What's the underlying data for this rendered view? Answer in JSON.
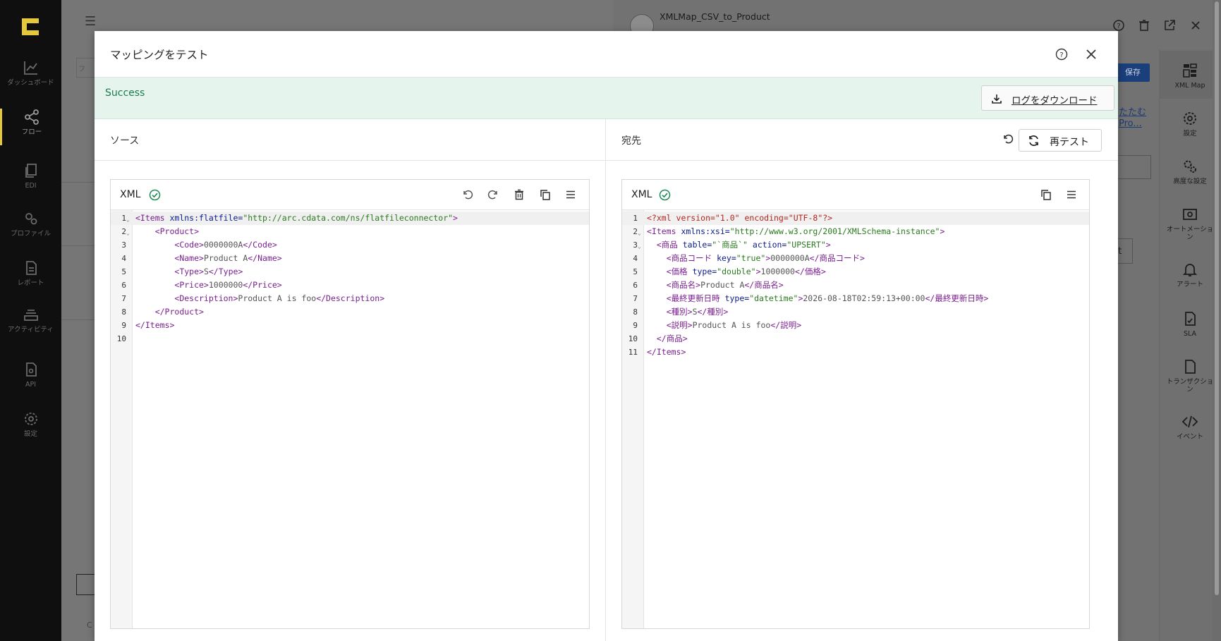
{
  "nav": {
    "items": [
      {
        "label": "ダッシュボード",
        "icon": "chart-line-icon"
      },
      {
        "label": "フロー",
        "icon": "share-flow-icon"
      },
      {
        "label": "EDI",
        "icon": "documents-icon"
      },
      {
        "label": "プロファイル",
        "icon": "gears-icon"
      },
      {
        "label": "レポート",
        "icon": "report-icon"
      },
      {
        "label": "アクティビティ",
        "icon": "stack-icon"
      },
      {
        "label": "API",
        "icon": "api-file-icon"
      },
      {
        "label": "設定",
        "icon": "gear-icon"
      }
    ],
    "active_index": 1
  },
  "background": {
    "flow_title": "XMLMap_CSV_to_Product",
    "save_label": "保存",
    "link1": "たたむ",
    "link2": "Pro...",
    "ct_label": "ct",
    "c_label": "C",
    "f_label": "フ"
  },
  "rail": {
    "items": [
      {
        "label": "XML Map",
        "icon": "xml-map-icon"
      },
      {
        "label": "設定",
        "icon": "gear-icon"
      },
      {
        "label": "高度な設定",
        "icon": "advanced-gears-icon"
      },
      {
        "label": "オートメーション",
        "icon": "automation-icon"
      },
      {
        "label": "アラート",
        "icon": "bell-icon"
      },
      {
        "label": "SLA",
        "icon": "sla-icon"
      },
      {
        "label": "トランザクション",
        "icon": "transaction-icon"
      },
      {
        "label": "イベント",
        "icon": "code-icon"
      }
    ]
  },
  "modal": {
    "title": "マッピングをテスト",
    "status": "Success",
    "download_label": "ログをダウンロード",
    "source_label": "ソース",
    "dest_label": "宛先",
    "retest_label": "再テスト",
    "source_editor": {
      "title": "XML",
      "lines": [
        [
          [
            "t-tag",
            "<Items "
          ],
          [
            "t-attr",
            "xmlns:flatfile="
          ],
          [
            "t-str",
            "\"http://arc.cdata.com/ns/flatfileconnector\""
          ],
          [
            "t-tag",
            ">"
          ]
        ],
        [
          [
            "t-txt",
            "    "
          ],
          [
            "t-tag",
            "<Product>"
          ]
        ],
        [
          [
            "t-txt",
            "        "
          ],
          [
            "t-tag",
            "<Code>"
          ],
          [
            "t-txt",
            "0000000A"
          ],
          [
            "t-tag",
            "</Code>"
          ]
        ],
        [
          [
            "t-txt",
            "        "
          ],
          [
            "t-tag",
            "<Name>"
          ],
          [
            "t-txt",
            "Product A"
          ],
          [
            "t-tag",
            "</Name>"
          ]
        ],
        [
          [
            "t-txt",
            "        "
          ],
          [
            "t-tag",
            "<Type>"
          ],
          [
            "t-txt",
            "S"
          ],
          [
            "t-tag",
            "</Type>"
          ]
        ],
        [
          [
            "t-txt",
            "        "
          ],
          [
            "t-tag",
            "<Price>"
          ],
          [
            "t-txt",
            "1000000"
          ],
          [
            "t-tag",
            "</Price>"
          ]
        ],
        [
          [
            "t-txt",
            "        "
          ],
          [
            "t-tag",
            "<Description>"
          ],
          [
            "t-txt",
            "Product A is foo"
          ],
          [
            "t-tag",
            "</Description>"
          ]
        ],
        [
          [
            "t-txt",
            "    "
          ],
          [
            "t-tag",
            "</Product>"
          ]
        ],
        [
          [
            "t-tag",
            "</Items>"
          ]
        ],
        []
      ],
      "fold_lines": [
        1,
        2
      ]
    },
    "dest_editor": {
      "title": "XML",
      "lines": [
        [
          [
            "t-pi",
            "<?xml version=\"1.0\" encoding=\"UTF-8\"?>"
          ]
        ],
        [
          [
            "t-tag",
            "<Items "
          ],
          [
            "t-attr",
            "xmlns:xsi="
          ],
          [
            "t-str",
            "\"http://www.w3.org/2001/XMLSchema-instance\""
          ],
          [
            "t-tag",
            ">"
          ]
        ],
        [
          [
            "t-txt",
            "  "
          ],
          [
            "t-tag",
            "<商品 "
          ],
          [
            "t-attr",
            "table="
          ],
          [
            "t-str",
            "\"`商品`\" "
          ],
          [
            "t-attr",
            "action="
          ],
          [
            "t-str",
            "\"UPSERT\""
          ],
          [
            "t-tag",
            ">"
          ]
        ],
        [
          [
            "t-txt",
            "    "
          ],
          [
            "t-tag",
            "<商品コード "
          ],
          [
            "t-attr",
            "key="
          ],
          [
            "t-str",
            "\"true\""
          ],
          [
            "t-tag",
            ">"
          ],
          [
            "t-txt",
            "0000000A"
          ],
          [
            "t-tag",
            "</商品コード>"
          ]
        ],
        [
          [
            "t-txt",
            "    "
          ],
          [
            "t-tag",
            "<価格 "
          ],
          [
            "t-attr",
            "type="
          ],
          [
            "t-str",
            "\"double\""
          ],
          [
            "t-tag",
            ">"
          ],
          [
            "t-txt",
            "1000000"
          ],
          [
            "t-tag",
            "</価格>"
          ]
        ],
        [
          [
            "t-txt",
            "    "
          ],
          [
            "t-tag",
            "<商品名>"
          ],
          [
            "t-txt",
            "Product A"
          ],
          [
            "t-tag",
            "</商品名>"
          ]
        ],
        [
          [
            "t-txt",
            "    "
          ],
          [
            "t-tag",
            "<最終更新日時 "
          ],
          [
            "t-attr",
            "type="
          ],
          [
            "t-str",
            "\"datetime\""
          ],
          [
            "t-tag",
            ">"
          ],
          [
            "t-txt",
            "2026-08-18T02:59:13+00:00"
          ],
          [
            "t-tag",
            "</最終更新日時>"
          ]
        ],
        [
          [
            "t-txt",
            "    "
          ],
          [
            "t-tag",
            "<種別>"
          ],
          [
            "t-txt",
            "S"
          ],
          [
            "t-tag",
            "</種別>"
          ]
        ],
        [
          [
            "t-txt",
            "    "
          ],
          [
            "t-tag",
            "<説明>"
          ],
          [
            "t-txt",
            "Product A is foo"
          ],
          [
            "t-tag",
            "</説明>"
          ]
        ],
        [
          [
            "t-txt",
            "  "
          ],
          [
            "t-tag",
            "</商品>"
          ]
        ],
        [
          [
            "t-tag",
            "</Items>"
          ]
        ]
      ],
      "fold_lines": [
        2,
        3
      ]
    }
  },
  "colors": {
    "success_bg": "#e6f4ee",
    "success_text": "#1f7a4d",
    "nav_bg": "#0f0f10",
    "nav_active": "#e5c93a"
  }
}
